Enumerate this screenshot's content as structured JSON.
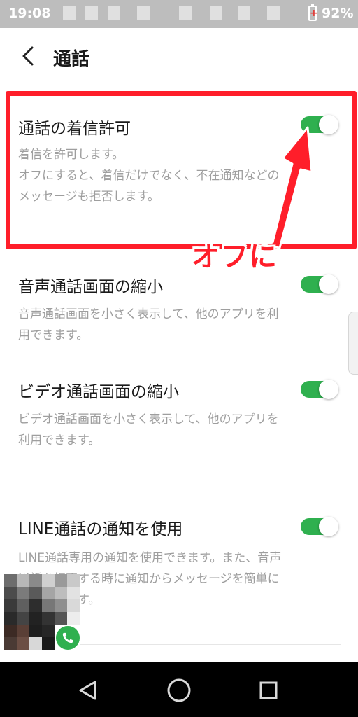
{
  "status_bar": {
    "time": "19:08",
    "battery": "92%"
  },
  "header": {
    "title": "通話"
  },
  "settings": [
    {
      "title": "通話の着信許可",
      "description_lines": [
        "着信を許可します。",
        "オフにすると、着信だけでなく、不在通知などの",
        "メッセージも拒否します。"
      ],
      "enabled": true
    },
    {
      "title": "音声通話画面の縮小",
      "description_lines": [
        "音声通話画面を小さく表示して、他のアプリを利",
        "用できます。"
      ],
      "enabled": true
    },
    {
      "title": "ビデオ通話画面の縮小",
      "description_lines": [
        "ビデオ通話画面を小さく表示して、他のアプリを",
        "利用できます。"
      ],
      "enabled": true
    },
    {
      "title": "LINE通話の通知を使用",
      "description_lines": [
        "LINE通話専用の通知を使用できます。また、音声",
        "通話を拒否する時に通知からメッセージを簡単に",
        "送信できます。"
      ],
      "enabled": true
    }
  ],
  "annotation": {
    "label": "オフに",
    "color": "#ff1e2a"
  },
  "colors": {
    "toggle_on": "#2fb04f",
    "description": "#9e9e9e"
  },
  "icons": {
    "back": "chevron-left-icon",
    "call": "phone-icon",
    "nav_back": "triangle-back-icon",
    "nav_home": "circle-home-icon",
    "nav_recents": "square-recents-icon"
  }
}
